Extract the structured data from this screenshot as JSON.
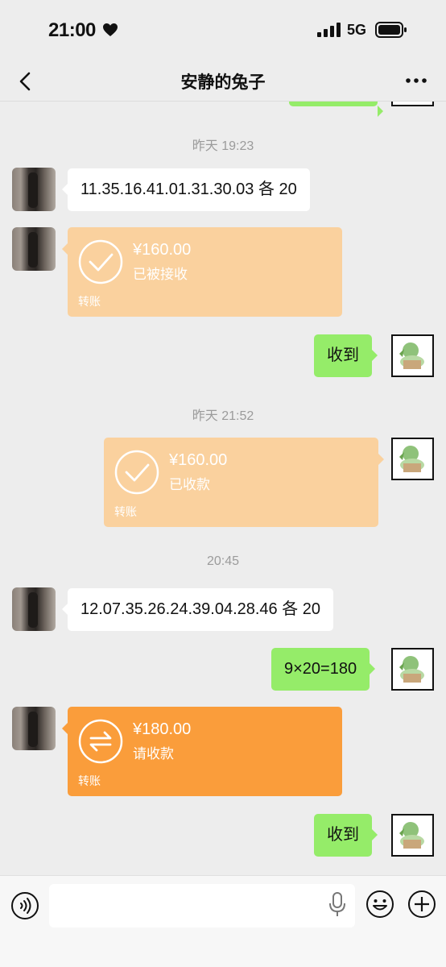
{
  "status_bar": {
    "time": "21:00",
    "network": "5G"
  },
  "header": {
    "title": "安静的兔子"
  },
  "messages": {
    "time1": "昨天 19:23",
    "msg1": "11.35.16.41.01.31.30.03 各 20",
    "transfer1": {
      "amount": "¥160.00",
      "status": "已被接收",
      "type": "转账"
    },
    "msg2": "收到",
    "time2": "昨天 21:52",
    "transfer2": {
      "amount": "¥160.00",
      "status": "已收款",
      "type": "转账"
    },
    "time3": "20:45",
    "msg3": "12.07.35.26.24.39.04.28.46 各 20",
    "msg4": "9×20=180",
    "transfer3": {
      "amount": "¥180.00",
      "status": "请收款",
      "type": "转账"
    },
    "msg5": "收到"
  },
  "colors": {
    "sent_bubble": "#95ec69",
    "received_bubble": "#ffffff",
    "transfer_done": "#fad19e",
    "transfer_pending": "#fa9d3b",
    "background": "#ededed"
  },
  "icons": {
    "status": [
      "heart-icon",
      "signal-icon",
      "battery-icon"
    ],
    "header": [
      "back-icon",
      "more-icon"
    ],
    "transfer": [
      "check-circle-icon",
      "exchange-arrows-icon"
    ],
    "input": [
      "voice-icon",
      "mic-icon",
      "emoji-icon",
      "plus-icon"
    ]
  }
}
